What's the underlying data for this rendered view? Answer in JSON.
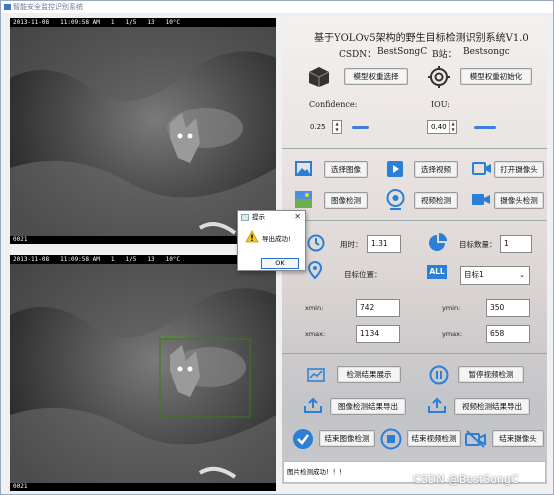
{
  "window": {
    "title": "智能安全监控识别系统"
  },
  "camera_top": {
    "header": [
      "2013-11-08",
      "11:09:58 AM",
      "1",
      "1/5",
      "13",
      "10°C"
    ],
    "footer": "0021"
  },
  "camera_bottom": {
    "header": [
      "2013-11-08",
      "11:09:58 AM",
      "1",
      "1/5",
      "13",
      "10°C"
    ],
    "footer": "0021",
    "detection_label": "Muntjac 0.91"
  },
  "panel": {
    "title": "基于YOLOv5架构的野生目标检测识别系统V1.0",
    "subtitle_csdn_label": "CSDN：",
    "subtitle_csdn_value": "BestSongC",
    "subtitle_b_label": "B站：",
    "subtitle_b_value": "Bestsongc",
    "model_select": "模型权重选择",
    "model_init": "模型权重初始化",
    "confidence_label": "Confidence:",
    "confidence_value": "0.25",
    "iou_label": "IOU:",
    "iou_value": "0.40",
    "confidence_level": 0.25,
    "iou_level": 0.4,
    "select_image": "选择图像",
    "select_video": "选择视频",
    "open_camera": "打开摄像头",
    "image_detect": "图像检测",
    "video_detect": "视频检测",
    "camera_detect": "摄像头检测",
    "time_label": "用时：",
    "time_value": "1.31",
    "target_count_label": "目标数量：",
    "target_count_value": "1",
    "target_pos_label": "目标位置：",
    "all_icon_text": "ALL",
    "target_select": "目标1",
    "xmin_label": "xmin:",
    "xmin_value": "742",
    "ymin_label": "ymin:",
    "ymin_value": "350",
    "xmax_label": "xmax:",
    "xmax_value": "1134",
    "ymax_label": "ymax:",
    "ymax_value": "658",
    "show_result": "检测结果展示",
    "pause_video": "暂停视频检测",
    "export_image": "图像检测结果导出",
    "export_video": "视频检测结果导出",
    "end_image": "结束图像检测",
    "end_video": "结束视频检测",
    "end_camera": "结束摄像头"
  },
  "dialog": {
    "title": "提示",
    "message": "导出成功!",
    "ok": "OK",
    "close": "✕"
  },
  "status_text": "图片检测成功！！！",
  "watermark": "CSDN @BestSongC",
  "colors": {
    "accent": "#3c7fd8",
    "slider": "#3c7fd8"
  }
}
